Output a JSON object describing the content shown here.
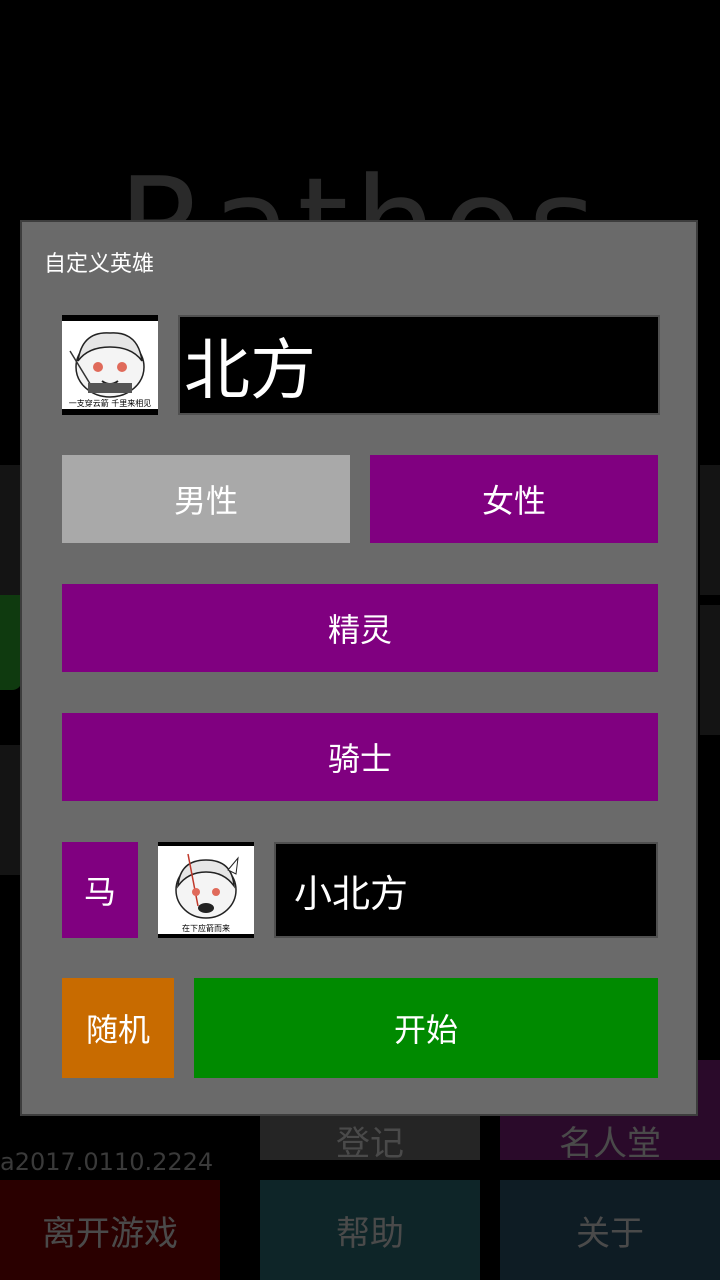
{
  "background": {
    "title": "Rathos",
    "version": "a2017.0110.2224",
    "tiles": {
      "register": "登记",
      "top_right": "名人堂",
      "quit": "离开游戏",
      "help": "帮助",
      "about": "关于"
    }
  },
  "dialog": {
    "title": "自定义英雄",
    "hero": {
      "avatar_icon": "hero-portrait",
      "avatar_caption": "一支穿云箭 千里来相见",
      "name_value": "北方"
    },
    "gender": {
      "male_label": "男性",
      "female_label": "女性",
      "selected": "female"
    },
    "race_label": "精灵",
    "class_label": "骑士",
    "mount": {
      "type_label": "马",
      "avatar_icon": "mount-portrait",
      "avatar_caption": "在下应箭而来",
      "name_value": "小北方"
    },
    "random_label": "随机",
    "start_label": "开始"
  },
  "colors": {
    "purple": "#800080",
    "gray_button": "#a9a9a9",
    "orange": "#c86b00",
    "green": "#008a00",
    "dialog_bg": "#6a6a6a"
  }
}
